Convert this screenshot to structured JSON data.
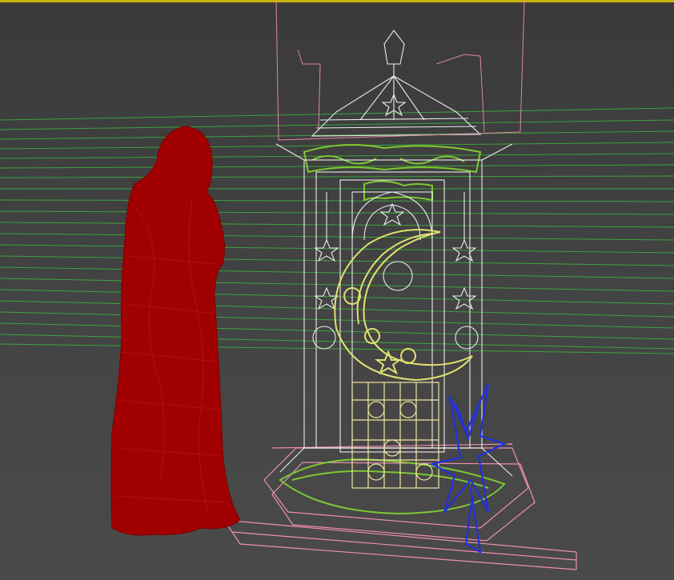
{
  "viewport": {
    "name": "3d-wireframe-viewport",
    "active_border_color": "#c8b400",
    "background_color": "#3f3f3f"
  },
  "scene_objects": [
    {
      "name": "human-figure-wireframe",
      "color": "#a00000"
    },
    {
      "name": "lantern-kiosk-wireframe",
      "color": "#ffffff"
    },
    {
      "name": "crescent-moon-ornament",
      "color": "#e0e070"
    },
    {
      "name": "green-filigree-ornaments",
      "color": "#7ec832"
    },
    {
      "name": "star-ornament-wireframe",
      "color": "#2030e0"
    },
    {
      "name": "lattice-panel",
      "color": "#f0e6a0"
    },
    {
      "name": "grid-floor-lines",
      "color": "#3cb43c"
    },
    {
      "name": "base-platform-outline",
      "color": "#f08fb0"
    }
  ]
}
